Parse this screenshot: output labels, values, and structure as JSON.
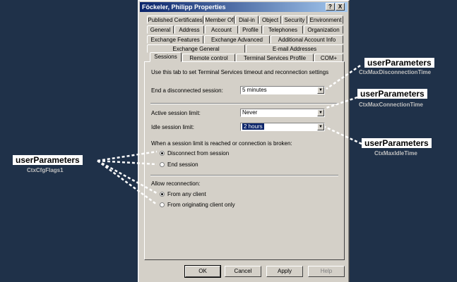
{
  "window": {
    "title": "Föckeler, Philipp Properties",
    "help_glyph": "?",
    "close_glyph": "X"
  },
  "tabs": {
    "row1": [
      "Published Certificates",
      "Member Of",
      "Dial-in",
      "Object",
      "Security",
      "Environment"
    ],
    "row2": [
      "General",
      "Address",
      "Account",
      "Profile",
      "Telephones",
      "Organization"
    ],
    "row3": [
      "Exchange Features",
      "Exchange Advanced",
      "Additional Account Info"
    ],
    "row4": [
      "Exchange General",
      "E-mail Addresses"
    ],
    "row5": [
      "Sessions",
      "Remote control",
      "Terminal Services Profile",
      "COM+"
    ]
  },
  "sessions": {
    "intro": "Use this tab to set Terminal Services timeout and reconnection settings",
    "end_disconnected_label": "End a disconnected session:",
    "end_disconnected_value": "5 minutes",
    "active_limit_label": "Active session limit:",
    "active_limit_value": "Never",
    "idle_limit_label": "Idle session limit:",
    "idle_limit_value": "2 hours",
    "broken_label": "When a session limit is reached or connection is broken:",
    "disconnect_option": "Disconnect from session",
    "end_option": "End session",
    "reconnect_label": "Allow reconnection:",
    "any_client_option": "From any client",
    "originating_option": "From originating client only"
  },
  "buttons": {
    "ok": "OK",
    "cancel": "Cancel",
    "apply": "Apply",
    "help": "Help"
  },
  "callouts": {
    "disconnection": {
      "title": "userParameters",
      "sub": "CtxMaxDisconnectionTime"
    },
    "connection": {
      "title": "userParameters",
      "sub": "CtxMaxConnectionTime"
    },
    "idle": {
      "title": "userParameters",
      "sub": "CtxMaxIdleTime"
    },
    "flags": {
      "title": "userParameters",
      "sub": "CtxCfgFlags1"
    }
  },
  "colors": {
    "background": "#1f3149",
    "dialog": "#d4d0c8",
    "titlebar": "#0a246a"
  }
}
